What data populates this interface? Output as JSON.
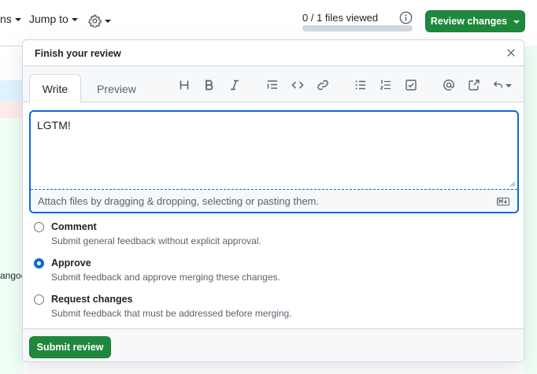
{
  "toolbar": {
    "conversations_fragment": "ns",
    "jump_to_label": "Jump to",
    "files_viewed": "0 / 1 files viewed",
    "files_viewed_fraction": 0,
    "review_changes_label": "Review changes"
  },
  "background": {
    "code_fragment": "angoc"
  },
  "popover": {
    "title": "Finish your review",
    "tabs": [
      {
        "label": "Write",
        "active": true
      },
      {
        "label": "Preview",
        "active": false
      }
    ],
    "toolbar_icons": [
      "heading-icon",
      "bold-icon",
      "italic-icon",
      "quote-icon",
      "code-icon",
      "link-icon",
      "bulleted-list-icon",
      "numbered-list-icon",
      "task-list-icon",
      "mention-icon",
      "cross-reference-icon",
      "saved-replies-icon"
    ],
    "comment_text": "LGTM!",
    "attach_hint": "Attach files by dragging & dropping, selecting or pasting them.",
    "options": [
      {
        "label": "Comment",
        "description": "Submit general feedback without explicit approval.",
        "checked": false
      },
      {
        "label": "Approve",
        "description": "Submit feedback and approve merging these changes.",
        "checked": true
      },
      {
        "label": "Request changes",
        "description": "Submit feedback that must be addressed before merging.",
        "checked": false
      }
    ],
    "submit_label": "Submit review"
  },
  "colors": {
    "accent_green": "#1f883d",
    "focus_blue": "#0969da"
  }
}
